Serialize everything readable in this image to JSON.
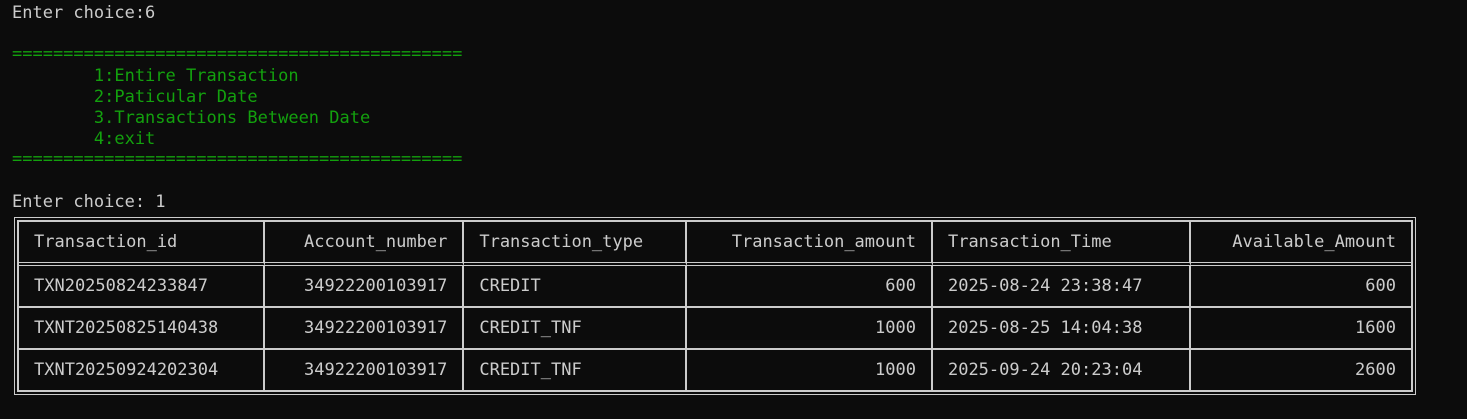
{
  "console": {
    "prompt_1": "Enter choice:6",
    "separator": "============================================",
    "menu": [
      "        1:Entire Transaction",
      "        2:Paticular Date",
      "        3.Transactions Between Date",
      "        4:exit"
    ],
    "prompt_2": "Enter choice: 1"
  },
  "table": {
    "headers": [
      "Transaction_id",
      "Account_number",
      "Transaction_type",
      "Transaction_amount",
      "Transaction_Time",
      "Available_Amount"
    ],
    "rows": [
      [
        "TXN20250824233847",
        "34922200103917",
        "CREDIT",
        "600",
        "2025-08-24 23:38:47",
        "600"
      ],
      [
        "TXNT20250825140438",
        "34922200103917",
        "CREDIT_TNF",
        "1000",
        "2025-08-25 14:04:38",
        "1600"
      ],
      [
        "TXNT20250924202304",
        "34922200103917",
        "CREDIT_TNF",
        "1000",
        "2025-09-24 20:23:04",
        "2600"
      ]
    ]
  },
  "colors": {
    "background": "#0c0c0c",
    "text": "#cccccc",
    "menu_green": "#13a10e"
  }
}
